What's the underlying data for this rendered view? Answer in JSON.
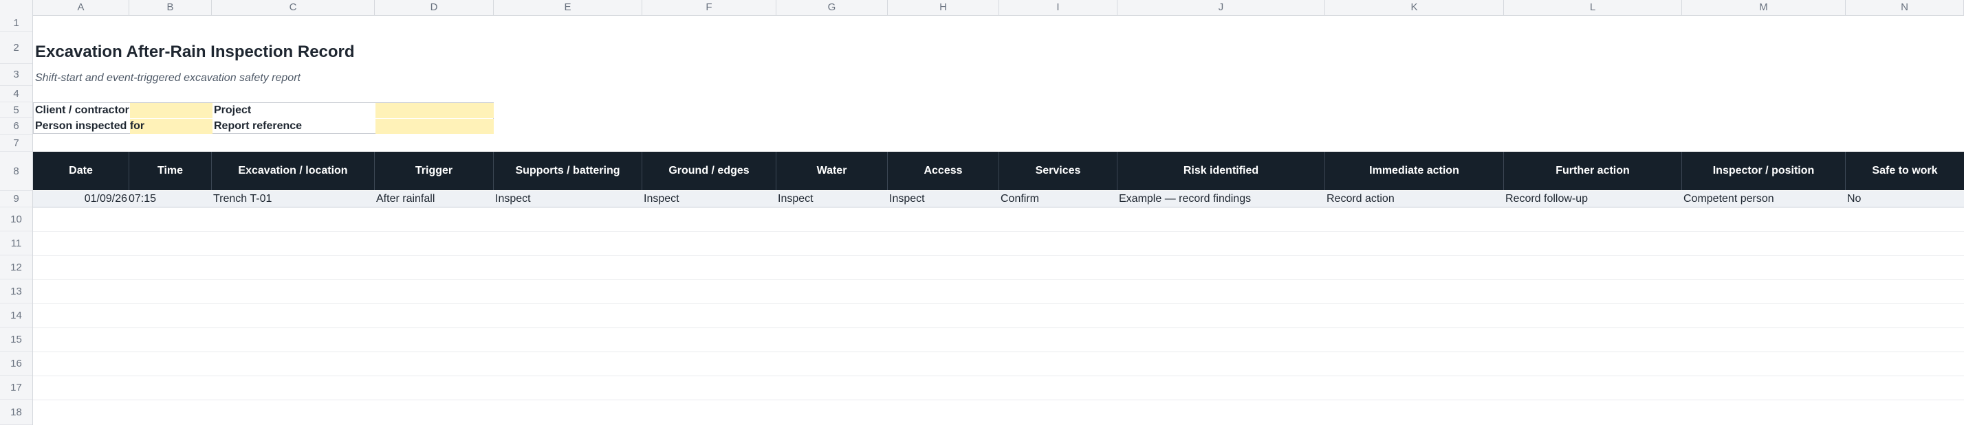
{
  "columns": [
    "A",
    "B",
    "C",
    "D",
    "E",
    "F",
    "G",
    "H",
    "I",
    "J",
    "K",
    "L",
    "M",
    "N"
  ],
  "rows": [
    "1",
    "2",
    "3",
    "4",
    "5",
    "6",
    "7",
    "8",
    "9",
    "10",
    "11",
    "12",
    "13",
    "14",
    "15",
    "16",
    "17",
    "18"
  ],
  "sheet": {
    "title": "Excavation After-Rain Inspection Record",
    "subtitle": "Shift-start and event-triggered excavation safety report"
  },
  "info": {
    "client_label": "Client / contractor",
    "client_value": "",
    "project_label": "Project",
    "project_value": "",
    "person_label": "Person inspected for",
    "person_value": "",
    "reference_label": "Report reference",
    "reference_value": ""
  },
  "table": {
    "headers": [
      "Date",
      "Time",
      "Excavation / location",
      "Trigger",
      "Supports / battering",
      "Ground / edges",
      "Water",
      "Access",
      "Services",
      "Risk identified",
      "Immediate action",
      "Further action",
      "Inspector / position",
      "Safe to work"
    ],
    "rows": [
      [
        "01/09/26",
        "07:15",
        "Trench T-01",
        "After rainfall",
        "Inspect",
        "Inspect",
        "Inspect",
        "Inspect",
        "Confirm",
        "Example — record findings",
        "Record action",
        "Record follow-up",
        "Competent person",
        "No"
      ]
    ]
  },
  "colors": {
    "header_bg": "#16202a",
    "input_fill": "#fff2b8",
    "row_band": "#eef1f5"
  }
}
